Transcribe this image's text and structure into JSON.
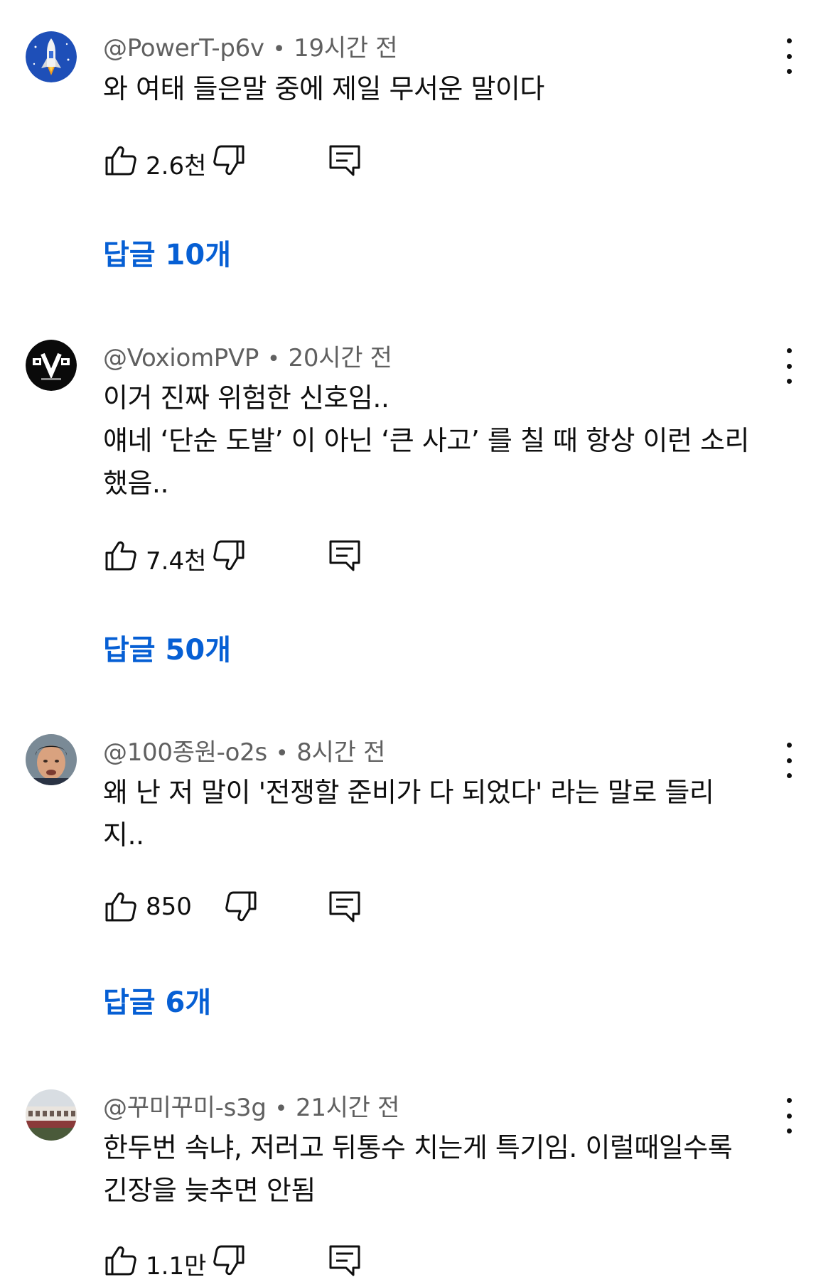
{
  "comments": [
    {
      "handle": "@PowerT-p6v",
      "time": "19시간 전",
      "lines": [
        "와 여태 들은말 중에 제일 무서운 말이다"
      ],
      "likes": "2.6천",
      "replies": "답글 10개",
      "avatar": "space-shuttle-avatar"
    },
    {
      "handle": "@VoxiomPVP",
      "time": "20시간 전",
      "lines": [
        "이거 진짜 위험한 신호임..",
        "얘네 ‘단순 도발’ 이 아닌 ‘큰 사고’ 를 칠 때 항상 이런 소리",
        "했음.."
      ],
      "likes": "7.4천",
      "replies": "답글 50개",
      "avatar": "voxiom-logo-avatar"
    },
    {
      "handle": "@100종원-o2s",
      "time": "8시간 전",
      "lines": [
        "왜 난 저 말이 '전쟁할 준비가 다 되었다' 라는 말로 들리",
        "지.."
      ],
      "likes": "850",
      "replies": "답글 6개",
      "avatar": "man-photo-avatar"
    },
    {
      "handle": "@꾸미꾸미-s3g",
      "time": "21시간 전",
      "lines": [
        "한두번 속냐, 저러고 뒤통수 치는게 특기임. 이럴때일수록",
        "긴장을 늦추면 안됨"
      ],
      "likes": "1.1만",
      "avatar": "building-photo-avatar"
    }
  ],
  "colors": {
    "link": "#065fd4",
    "meta": "#606060",
    "text": "#0f0f0f"
  },
  "icons": {
    "like": "thumbs-up-icon",
    "dislike": "thumbs-down-icon",
    "reply": "reply-icon",
    "more": "more-vert-icon"
  }
}
